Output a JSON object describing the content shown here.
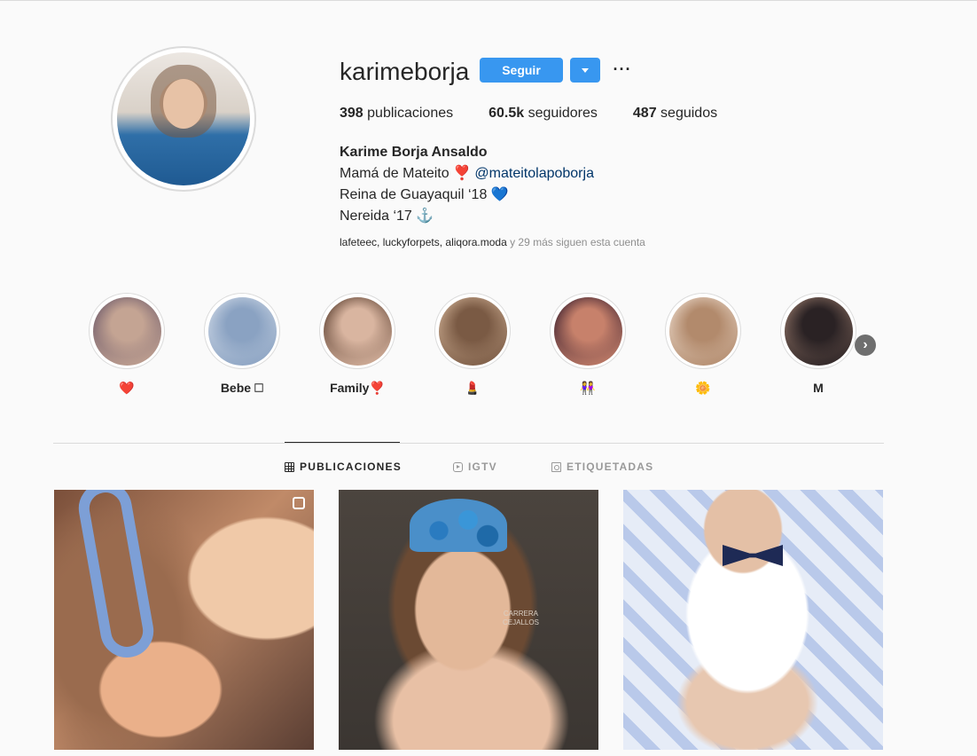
{
  "profile": {
    "username": "karimeborja",
    "follow_label": "Seguir",
    "more_label": "···",
    "stats": {
      "posts_count": "398",
      "posts_label": "publicaciones",
      "followers_count": "60.5k",
      "followers_label": "seguidores",
      "following_count": "487",
      "following_label": "seguidos"
    },
    "full_name": "Karime Borja Ansaldo",
    "bio_line1_text": "Mamá de Mateito ❣️ ",
    "bio_line1_link": "@mateitolapoborja",
    "bio_line2": "Reina de Guayaquil ‘18 💙",
    "bio_line3": "Nereida ‘17 ⚓️",
    "followed_by_names": "lafeteec, luckyforpets, aliqora.moda",
    "followed_by_suffix": " y 29 más siguen esta cuenta"
  },
  "highlights": [
    {
      "label": "❤️",
      "colors": [
        "#6e5a6a",
        "#c4a493"
      ]
    },
    {
      "label": "Bebe 🗆",
      "colors": [
        "#c9d4e3",
        "#8aa2c2"
      ]
    },
    {
      "label": "Family❣️",
      "colors": [
        "#5b3f30",
        "#d9b5a0"
      ]
    },
    {
      "label": "💄",
      "colors": [
        "#c8a98e",
        "#7a5a44"
      ]
    },
    {
      "label": "👭",
      "colors": [
        "#3b1f2e",
        "#c7816b"
      ]
    },
    {
      "label": "🌼",
      "colors": [
        "#e6d3c3",
        "#b28a6c"
      ]
    },
    {
      "label": "M",
      "colors": [
        "#8b6f62",
        "#2a2224"
      ]
    }
  ],
  "highlights_next": "›",
  "tabs": [
    {
      "label": "PUBLICACIONES",
      "icon": "grid-icon",
      "active": true
    },
    {
      "label": "IGTV",
      "icon": "igtv-icon",
      "active": false
    },
    {
      "label": "ETIQUETADAS",
      "icon": "tag-icon",
      "active": false
    }
  ],
  "posts": [
    {
      "subject": "newborn sleeping on mother",
      "multi": true
    },
    {
      "subject": "woman with crown holding baby",
      "watermark": "CARRERA\nCEJALLOS"
    },
    {
      "subject": "baby with bow tie in car seat",
      "multi": false
    }
  ],
  "colors": {
    "accent": "#3897f0",
    "link": "#003569",
    "muted": "#8e8e8e",
    "border": "#dbdbdb"
  }
}
